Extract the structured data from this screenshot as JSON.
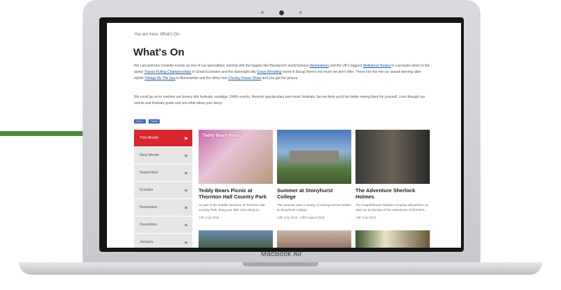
{
  "device": {
    "brand": "MacBook Air"
  },
  "page": {
    "breadcrumb": "You are here: What's On",
    "title": "What's On",
    "intro": {
      "text_1": "We Lancastrians consider events as one of our specialities; starting with the biggies like Blackpool's world famous ",
      "link_1": "Illuminations",
      "text_2": " and the UK's biggest ",
      "link_2": "Walkabout theatre",
      "text_3": " in Lancaster down to the quirky ",
      "link_3": "Tractor Pulling Championships",
      "text_4": " in Great Eccleston and the downright silly ",
      "link_4": "Gravy Wrestling",
      "text_5": " event in Bacup there's not much we don't offer. Throw into the mix our award winning uber-stylish ",
      "link_5": "Vintage By The Sea",
      "text_6": " in Morecambe and the shiny new ",
      "link_6": "Chorley Flower Show",
      "text_7": " and you get the picture."
    },
    "para2": "We could go on to mention our breezy kite festivals, nostalgic 1940s events, firework spectaculars and music festivals, but we think you'd be better seeing them for yourself. Look through our events and festivals guide and see what takes your fancy.",
    "social": {
      "like": "Like 1",
      "tweet": "Tweet"
    },
    "menu": [
      {
        "label": "This Month",
        "active": true
      },
      {
        "label": "Next Month"
      },
      {
        "label": "September"
      },
      {
        "label": "October"
      },
      {
        "label": "November"
      },
      {
        "label": "December"
      },
      {
        "label": "January"
      }
    ],
    "cards": [
      {
        "image_text": "Teddy Bears Picnic",
        "title": "Teddy Bears Picnic at Thornton Hall Country Park",
        "desc": "As part of the Toddler Sessions at Thornton Hall Country Park, bring your little ones along to...",
        "date": "12th July 2018"
      },
      {
        "title": "Summer at Stonyhurst College",
        "desc": "This summer sees a variety of exciting events hosted at Stonyhurst College.",
        "date": "13th July 2018 - 19th August 2018"
      },
      {
        "title": "The Adventure Sherlock Holmes",
        "desc": "The Chapterhouse Theatre Company will perform an open-air production of the Adventures of Sherlock...",
        "date": "13th July 2018"
      }
    ]
  }
}
